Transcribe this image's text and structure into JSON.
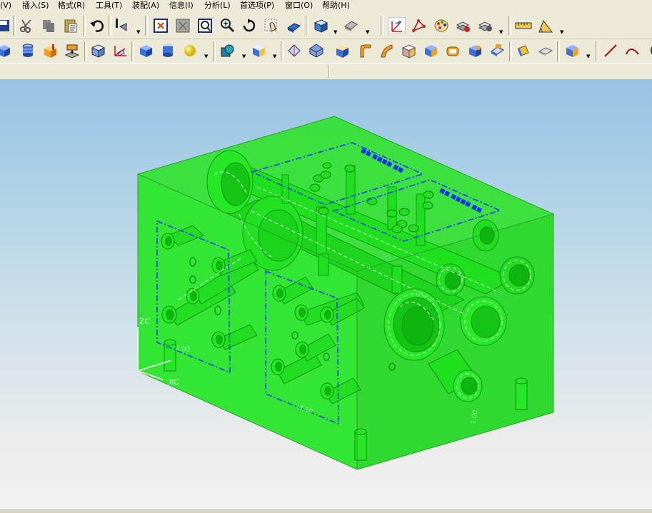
{
  "menu": [
    "(V)",
    "插入(S)",
    "格式(R)",
    "工具(T)",
    "装配(A)",
    "信息(I)",
    "分析(L)",
    "首选项(P)",
    "窗口(O)",
    "帮助(H)"
  ],
  "toolbar1": [
    "save-icon",
    "cut-icon",
    "copy-icon",
    "paste-icon",
    "undo-icon",
    "info-icon",
    "fit-icon",
    "zoom-region-icon",
    "zoom-window-icon",
    "zoom-icon",
    "rotate-icon",
    "pan-icon",
    "perspective-icon",
    "view-orient-icon",
    "shaded-icon",
    "render-style-icon",
    "wcs-icon",
    "point-icon",
    "color-palette-icon",
    "layer-icon",
    "layer-settings-icon",
    "measure-distance-icon",
    "measure-angle-icon"
  ],
  "toolbar2": [
    "block-icon",
    "cylinder-icon",
    "feature-icon",
    "extrude-icon",
    "box-feature-icon",
    "datum-csys-icon",
    "box-icon",
    "cylinder2-icon",
    "sphere-icon",
    "boolean-icon",
    "offset-icon",
    "face-icon",
    "body-icon",
    "chamfer-icon",
    "blend-icon",
    "sweep-icon",
    "shell-icon",
    "hollow-icon",
    "thicken-icon",
    "pad-icon",
    "trim-icon",
    "patch-icon",
    "plate-icon",
    "sew-icon",
    "line-icon",
    "arc-icon"
  ],
  "viewport": {
    "axis_labels": {
      "zc": "ZC",
      "xc": "XC"
    },
    "model_labels": [
      "4.00",
      "4.10",
      "1.00"
    ],
    "colors": {
      "body": "#33e633",
      "edge": "#2aa32a",
      "annotation": "#1030ff"
    }
  }
}
